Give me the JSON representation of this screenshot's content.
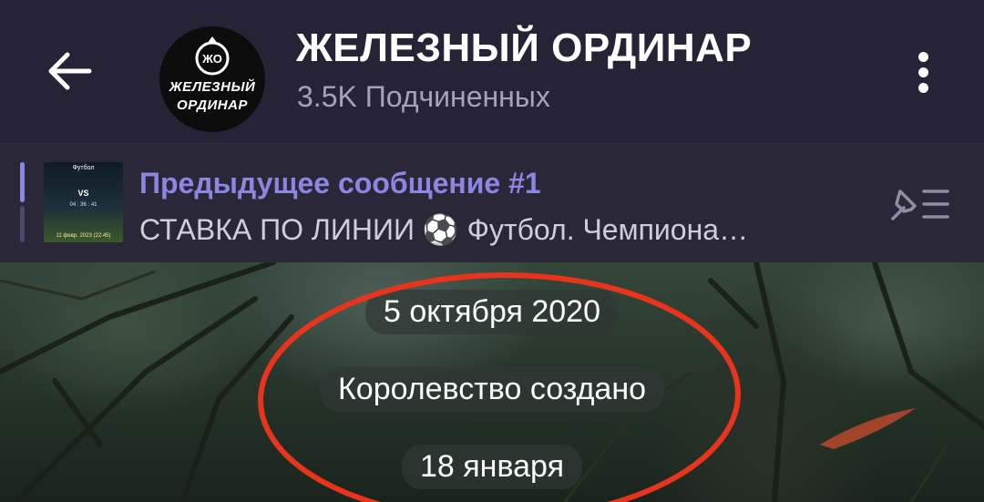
{
  "header": {
    "title": "ЖЕЛЕЗНЫЙ ОРДИНАР",
    "subscribers": "3.5K Подчиненных",
    "avatar": {
      "mark": "ЖО",
      "line1": "ЖЕЛЕЗНЫЙ",
      "line2": "ОРДИНАР"
    },
    "back_icon": "arrow-left-icon",
    "menu_icon": "more-vertical-icon"
  },
  "pinned": {
    "title": "Предыдущее сообщение #1",
    "text": "СТАВКА ПО ЛИНИИ ⚽ Футбол. Чемпиона…",
    "thumb": {
      "title": "Футбол",
      "vs": "VS",
      "timer": "04 : 36 : 41",
      "date": "11 февр. 2023 (22:45)"
    },
    "list_icon": "pinned-list-icon"
  },
  "chat": {
    "date_1": "5 октября 2020",
    "service_message": "Королевство создано",
    "date_2": "18 января"
  },
  "colors": {
    "header_bg": "#262336",
    "pin_accent": "#8b86e0",
    "highlight": "#e8341c"
  }
}
